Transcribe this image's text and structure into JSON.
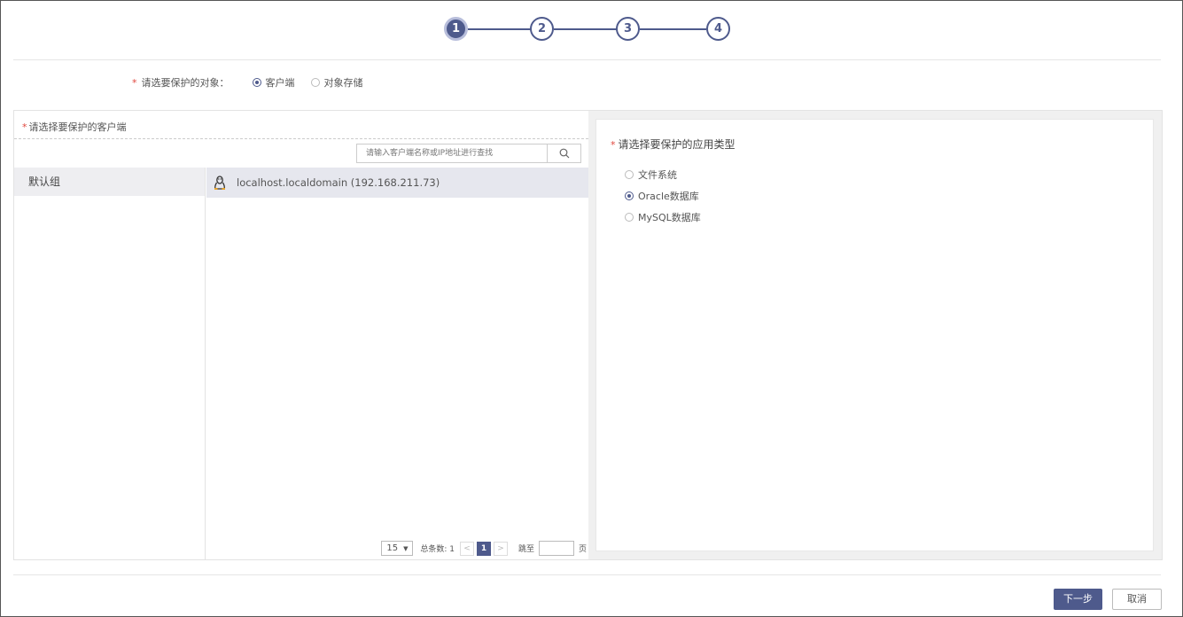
{
  "stepper": {
    "steps": [
      "1",
      "2",
      "3",
      "4"
    ],
    "active_step": 1,
    "accent_color": "#4e5a8c"
  },
  "object_selection": {
    "label": "请选要保护的对象：",
    "options": [
      {
        "label": "客户端",
        "checked": true
      },
      {
        "label": "对象存储",
        "checked": false
      }
    ]
  },
  "client_panel": {
    "title": "请选择要保护的客户端",
    "search_placeholder": "请输入客户端名称或IP地址进行查找",
    "search_icon": "search-icon",
    "groups": [
      "默认组"
    ],
    "clients": [
      {
        "icon": "linux-icon",
        "label": "localhost.localdomain (192.168.211.73)"
      }
    ],
    "pagination": {
      "page_size": "15",
      "total_label": "总条数: 1",
      "prev": "<",
      "current_page": "1",
      "next": ">",
      "jump_label": "跳至",
      "page_suffix": "页"
    }
  },
  "app_panel": {
    "title": "请选择要保护的应用类型",
    "options": [
      {
        "label": "文件系统",
        "checked": false
      },
      {
        "label": "Oracle数据库",
        "checked": true
      },
      {
        "label": "MySQL数据库",
        "checked": false
      }
    ]
  },
  "footer": {
    "next_label": "下一步",
    "cancel_label": "取消"
  }
}
